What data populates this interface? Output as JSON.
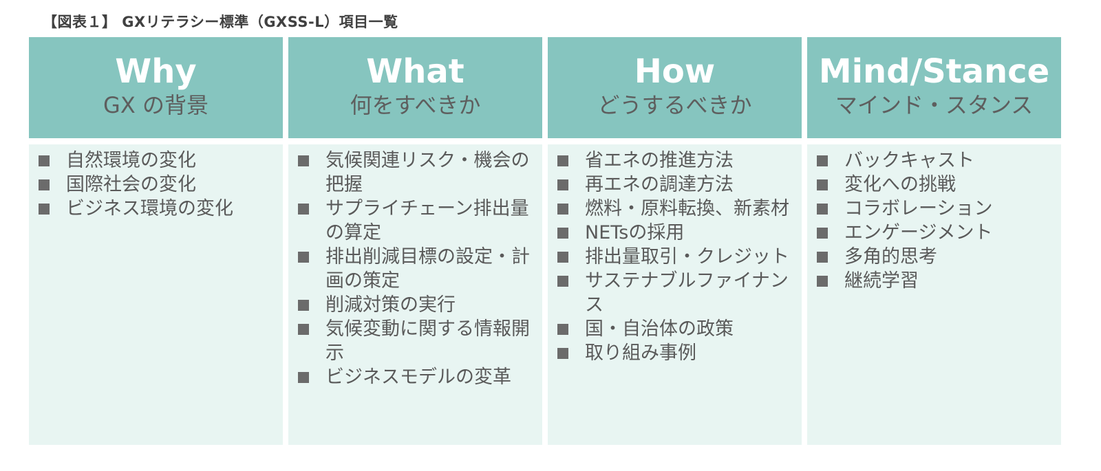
{
  "figure": {
    "title": "【図表１】 GXリテラシー標準（GXSS-L）項目一覧"
  },
  "colors": {
    "header_bg": "#86c5bf",
    "header_en_text": "#ffffff",
    "header_ja_text": "#5e5e5e",
    "body_bg": "#e8f5f2",
    "bullet": "#6b6b6b",
    "body_text": "#5a5a5a"
  },
  "columns": [
    {
      "title_en": "Why",
      "title_ja": "GX の背景",
      "items": [
        "自然環境の変化",
        "国際社会の変化",
        "ビジネス環境の変化"
      ]
    },
    {
      "title_en": "What",
      "title_ja": "何をすべきか",
      "items": [
        "気候関連リスク・機会の把握",
        "サプライチェーン排出量の算定",
        "排出削減目標の設定・計画の策定",
        "削減対策の実行",
        "気候変動に関する情報開示",
        "ビジネスモデルの変革"
      ]
    },
    {
      "title_en": "How",
      "title_ja": "どうするべきか",
      "items": [
        "省エネの推進方法",
        "再エネの調達方法",
        "燃料・原料転換、新素材",
        "NETsの採用",
        "排出量取引・クレジット",
        "サステナブルファイナンス",
        "国・自治体の政策",
        "取り組み事例"
      ]
    },
    {
      "title_en": "Mind/Stance",
      "title_ja": "マインド・スタンス",
      "items": [
        "バックキャスト",
        "変化への挑戦",
        "コラボレーション",
        "エンゲージメント",
        "多角的思考",
        "継続学習"
      ]
    }
  ]
}
